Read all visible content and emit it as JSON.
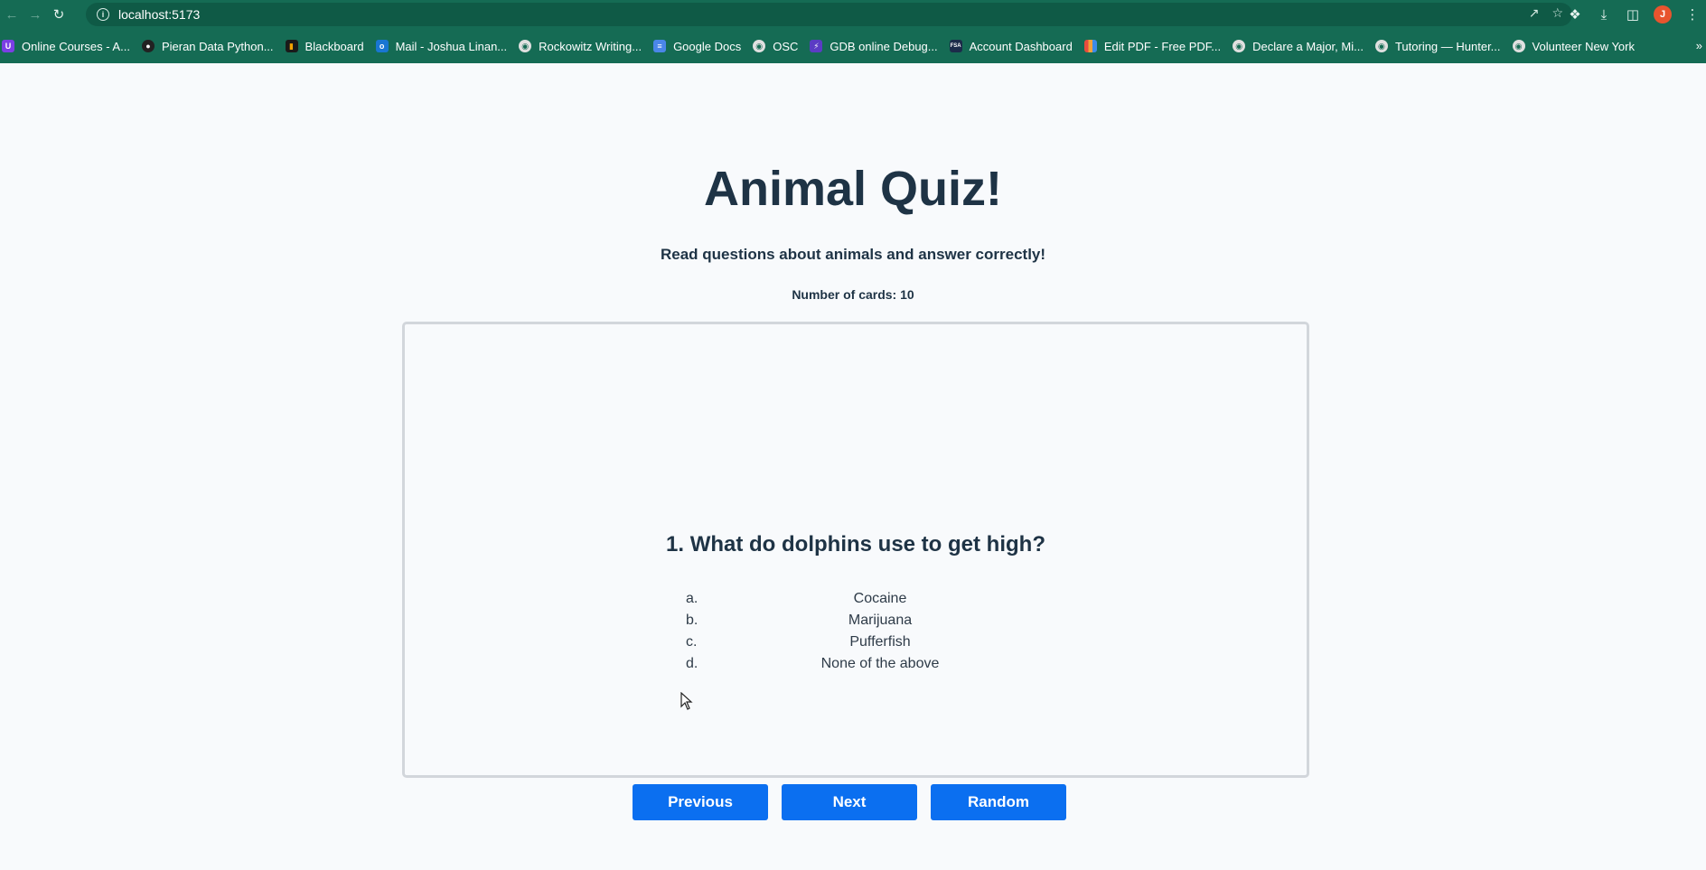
{
  "browser": {
    "url": "localhost:5173",
    "avatar_initial": "J",
    "bookmarks": [
      {
        "label": "Online Courses - A...",
        "icon": "purple-shield-icon",
        "color": "#7b3fe4"
      },
      {
        "label": "Pieran Data Python...",
        "icon": "github-icon",
        "color": "#222222"
      },
      {
        "label": "Blackboard",
        "icon": "blackboard-icon",
        "color": "#1a1a1a"
      },
      {
        "label": "Mail - Joshua Linan...",
        "icon": "outlook-icon",
        "color": "#1976d2"
      },
      {
        "label": "Rockowitz Writing...",
        "icon": "globe-icon",
        "color": "#e0e0e0"
      },
      {
        "label": "Google Docs",
        "icon": "docs-icon",
        "color": "#4a86e8"
      },
      {
        "label": "OSC",
        "icon": "globe-icon",
        "color": "#e0e0e0"
      },
      {
        "label": "GDB online Debug...",
        "icon": "bolt-icon",
        "color": "#5b3cc4"
      },
      {
        "label": "Account Dashboard",
        "icon": "fsa-icon",
        "color": "#1c2b4a"
      },
      {
        "label": "Edit PDF - Free PDF...",
        "icon": "pdf-grid-icon",
        "color": "#f2a23a"
      },
      {
        "label": "Declare a Major, Mi...",
        "icon": "globe-icon",
        "color": "#e0e0e0"
      },
      {
        "label": "Tutoring — Hunter...",
        "icon": "globe-icon",
        "color": "#e0e0e0"
      },
      {
        "label": "Volunteer New York",
        "icon": "globe-icon",
        "color": "#e0e0e0"
      }
    ]
  },
  "page": {
    "title": "Animal Quiz!",
    "subtitle": "Read questions about animals and answer correctly!",
    "count": "Number of cards: 10"
  },
  "card": {
    "question": "1. What do dolphins use to get high?",
    "options": [
      {
        "letter": "a.",
        "text": "Cocaine"
      },
      {
        "letter": "b.",
        "text": "Marijuana"
      },
      {
        "letter": "c.",
        "text": "Pufferfish"
      },
      {
        "letter": "d.",
        "text": "None of the above"
      }
    ]
  },
  "buttons": {
    "previous": "Previous",
    "next": "Next",
    "random": "Random"
  }
}
